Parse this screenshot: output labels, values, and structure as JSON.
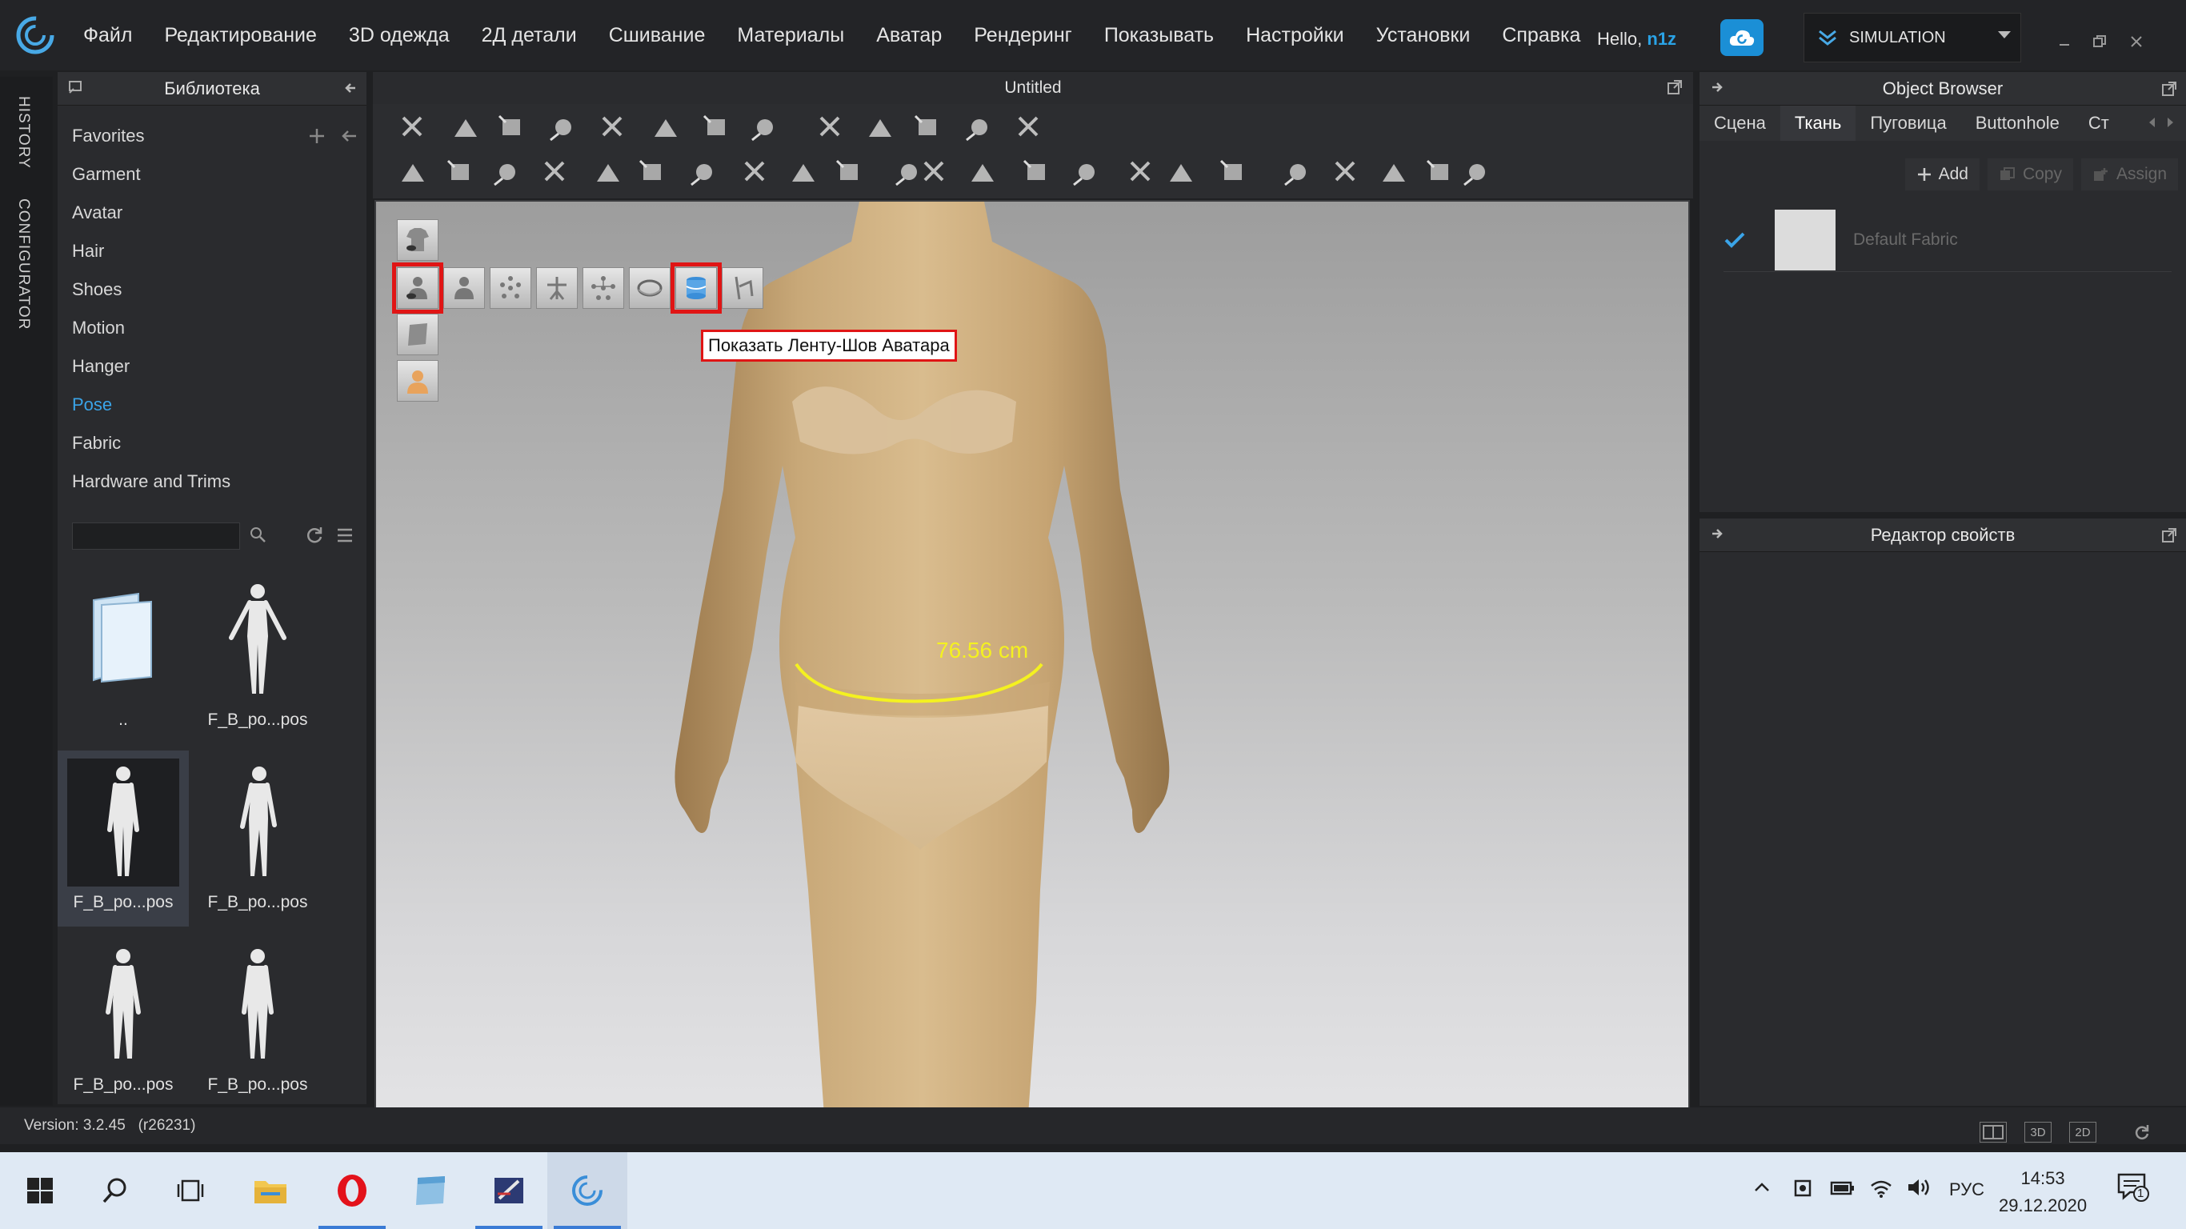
{
  "menubar": {
    "items": [
      "Файл",
      "Редактирование",
      "3D одежда",
      "2Д детали",
      "Сшивание",
      "Материалы",
      "Аватар",
      "Рендеринг",
      "Показывать",
      "Настройки",
      "Установки",
      "Справка"
    ],
    "hello_prefix": "Hello,",
    "username": "n1z",
    "mode_label": "SIMULATION"
  },
  "vtabs": {
    "history": "HISTORY",
    "configurator": "CONFIGURATOR"
  },
  "library": {
    "title": "Библиотека",
    "items": [
      "Favorites",
      "Garment",
      "Avatar",
      "Hair",
      "Shoes",
      "Motion",
      "Hanger",
      "Pose",
      "Fabric",
      "Hardware and Trims"
    ],
    "active_item": "Pose",
    "search_value": "",
    "thumbs": [
      "..",
      "F_B_po...pos",
      "F_B_po...pos",
      "F_B_po...pos",
      "F_B_po...pos",
      "F_B_po...pos"
    ]
  },
  "center": {
    "title": "Untitled",
    "tooltip": "Показать Ленту-Шов Аватара",
    "measurement": "76.56 cm"
  },
  "object_browser": {
    "title": "Object Browser",
    "tabs": [
      "Сцена",
      "Ткань",
      "Пуговица",
      "Buttonhole",
      "Ст"
    ],
    "active_tab": "Ткань",
    "add_label": "Add",
    "copy_label": "Copy",
    "assign_label": "Assign",
    "fabric_name": "Default Fabric"
  },
  "property_editor": {
    "title": "Редактор свойств"
  },
  "status": {
    "version": "Version: 3.2.45",
    "revision": "(r26231)",
    "view_2d": "2D",
    "view_3d": "3D"
  },
  "taskbar": {
    "lang": "РУС",
    "time": "14:53",
    "date": "29.12.2020",
    "notif_count": "1"
  },
  "colors": {
    "accent": "#3aa4e8",
    "highlight": "#e01515",
    "measure": "#f4f120",
    "panel": "#2a2b2e"
  }
}
